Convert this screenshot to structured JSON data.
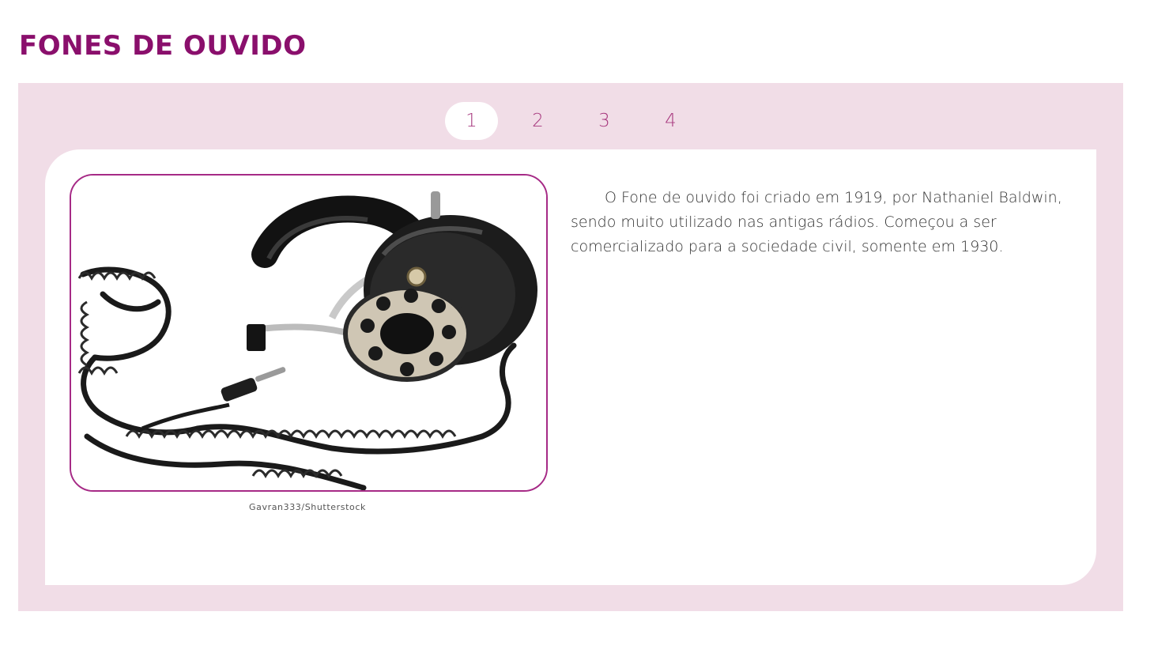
{
  "page": {
    "title": "FONES DE OUVIDO"
  },
  "carousel": {
    "tabs": [
      {
        "label": "1",
        "active": true
      },
      {
        "label": "2",
        "active": false
      },
      {
        "label": "3",
        "active": false
      },
      {
        "label": "4",
        "active": false
      }
    ],
    "slide": {
      "image_icon": "headphones-photo",
      "credit": "Gavran333/Shutterstock",
      "text": "O Fone de ouvido foi criado em 1919, por Nathaniel Baldwin, sendo muito utilizado nas antigas rádios. Começou a ser comercializado para a sociedade civil, somente em 1930."
    }
  },
  "colors": {
    "title": "#8a0f6c",
    "frame_background": "#f1dde7",
    "accent_border": "#a62a86",
    "tab_text": "#a8397f"
  }
}
